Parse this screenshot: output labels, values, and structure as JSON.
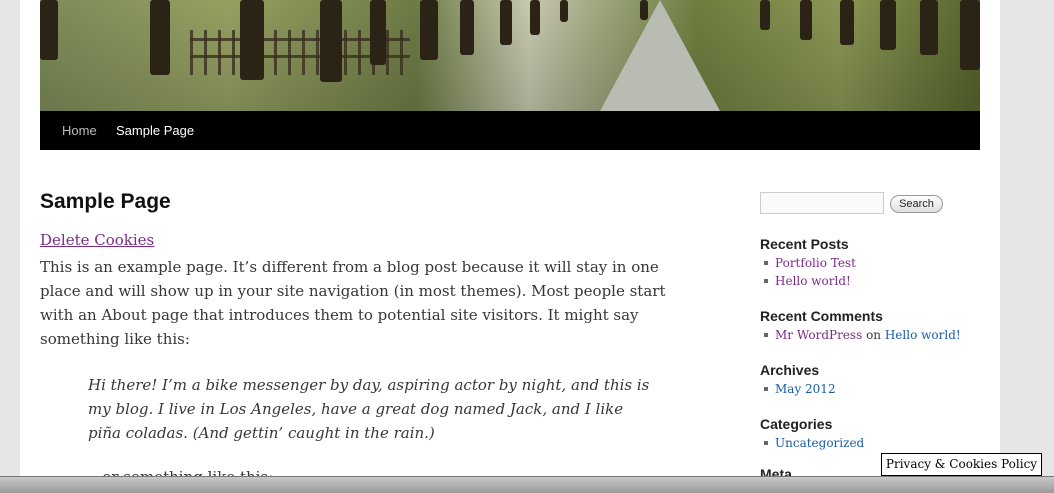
{
  "nav": {
    "items": [
      "Home",
      "Sample Page"
    ]
  },
  "page": {
    "title": "Sample Page",
    "delete_cookies_link": "Delete Cookies",
    "paragraph": "This is an example page. It’s different from a blog post because it will stay in one place and will show up in your site navigation (in most themes). Most people start with an About page that introduces them to potential site visitors. It might say something like this:",
    "quote": "Hi there! I’m a bike messenger by day, aspiring actor by night, and this is my blog. I live in Los Angeles, have a great dog named Jack, and I like piña coladas. (And gettin’ caught in the rain.)",
    "trailing_text": "...or something like this:"
  },
  "sidebar": {
    "search": {
      "placeholder": "",
      "button_label": "Search"
    },
    "recent_posts": {
      "title": "Recent Posts",
      "items": [
        "Portfolio Test",
        "Hello world!"
      ]
    },
    "recent_comments": {
      "title": "Recent Comments",
      "author": "Mr WordPress",
      "connector": "on",
      "post": "Hello world!"
    },
    "archives": {
      "title": "Archives",
      "items": [
        "May 2012"
      ]
    },
    "categories": {
      "title": "Categories",
      "items": [
        "Uncategorized"
      ]
    },
    "meta": {
      "title": "Meta"
    }
  },
  "privacy_widget": {
    "label": "Privacy & Cookies Policy"
  }
}
